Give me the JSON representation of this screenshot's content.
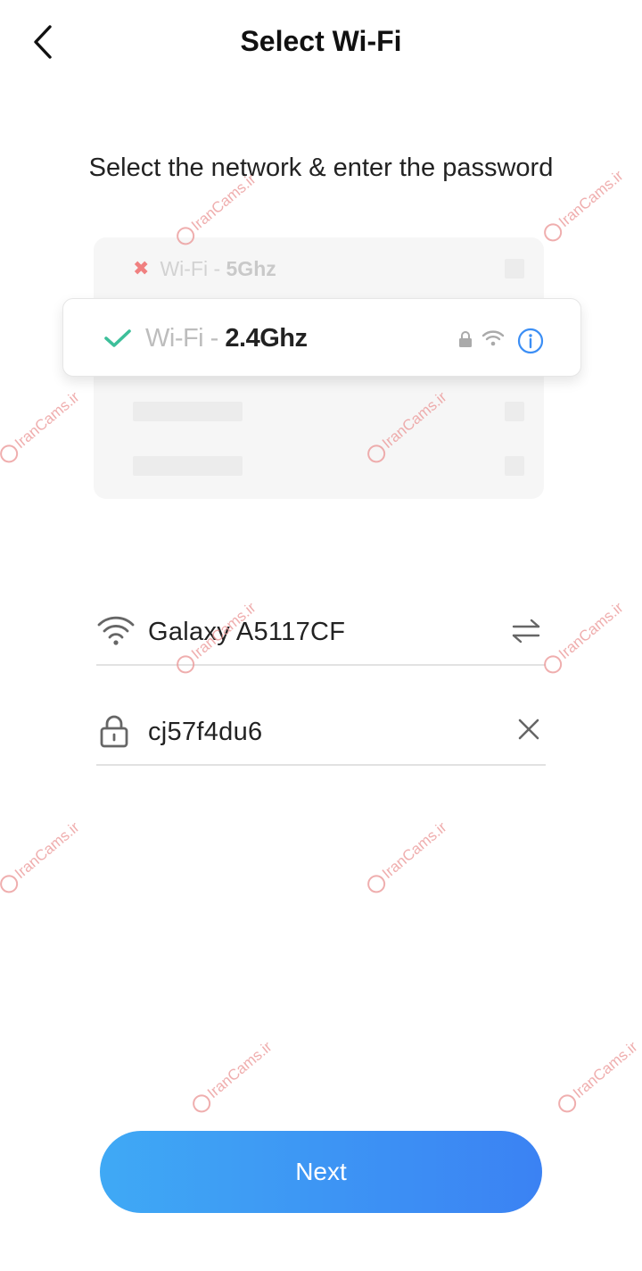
{
  "header": {
    "title": "Select Wi-Fi"
  },
  "subtitle": "Select the network & enter the password",
  "illustration": {
    "row_5g": {
      "prefix": "Wi-Fi - ",
      "band": "5Ghz"
    },
    "row_24g": {
      "prefix": "Wi-Fi - ",
      "band": "2.4Ghz"
    }
  },
  "form": {
    "network_name": "Galaxy A5117CF",
    "password": "cj57f4du6"
  },
  "next_label": "Next",
  "watermark": "IranCams.ir",
  "colors": {
    "accent": "#3b8ef5",
    "check": "#3dbf9a",
    "error_x": "#f08080"
  }
}
